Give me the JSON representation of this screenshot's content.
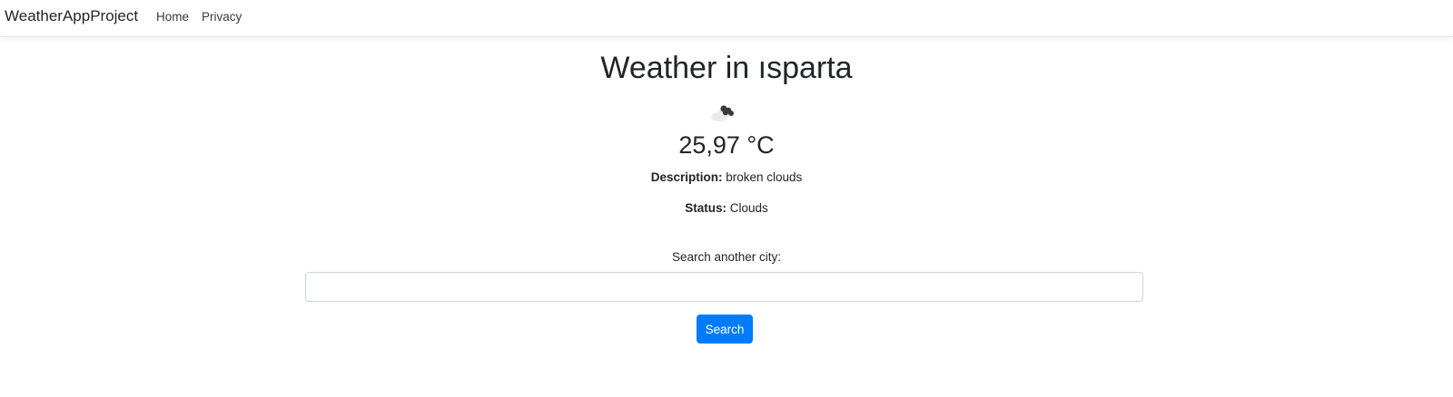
{
  "navbar": {
    "brand": "WeatherAppProject",
    "links": [
      {
        "label": "Home"
      },
      {
        "label": "Privacy"
      }
    ]
  },
  "weather": {
    "title": "Weather in ısparta",
    "icon": "broken-clouds-icon",
    "temperature": "25,97 °C",
    "description_label": "Description:",
    "description_value": " broken clouds",
    "status_label": "Status:",
    "status_value": " Clouds"
  },
  "search": {
    "label": "Search another city:",
    "input_value": "",
    "placeholder": "",
    "button_label": "Search"
  },
  "colors": {
    "primary": "#007bff",
    "text": "#212529",
    "border": "#ced4da"
  }
}
